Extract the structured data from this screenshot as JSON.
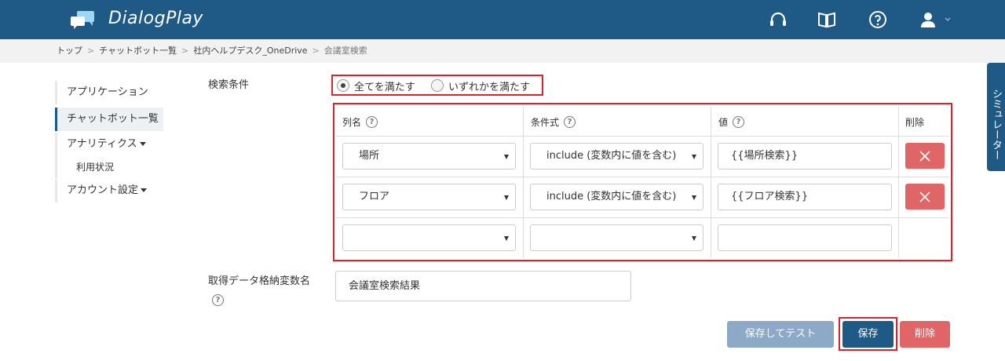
{
  "header": {
    "app_name": "DialogPlay",
    "icons": [
      "headset-icon",
      "book-icon",
      "help-icon",
      "user-icon"
    ],
    "color": "#1f5a87"
  },
  "breadcrumb": {
    "items": [
      "トップ",
      "チャットボット一覧",
      "社内ヘルプデスク_OneDrive"
    ],
    "current": "会議室検索",
    "separator": ">"
  },
  "sidebar": {
    "items": [
      {
        "label": "アプリケーション"
      },
      {
        "label": "チャットボット一覧"
      },
      {
        "label": "アナリティクス"
      },
      {
        "label": "利用状況"
      },
      {
        "label": "アカウント設定"
      }
    ]
  },
  "search": {
    "label": "検索条件",
    "options": [
      {
        "label": "全てを満たす",
        "checked": true
      },
      {
        "label": "いずれかを満たす",
        "checked": false
      }
    ]
  },
  "table": {
    "headers": [
      "列名",
      "条件式",
      "値",
      "削除"
    ],
    "rows": [
      {
        "column": "場所",
        "condition": "include (変数内に値を含む)",
        "value": "{{場所検索}}"
      },
      {
        "column": "フロア",
        "condition": "include (変数内に値を含む)",
        "value": "{{フロア検索}}"
      },
      {
        "column": "",
        "condition": "",
        "value": ""
      }
    ]
  },
  "result_var": {
    "label": "取得データ格納変数名",
    "value": "会議室検索結果"
  },
  "buttons": {
    "save_test": "保存してテスト",
    "save": "保存",
    "delete": "削除"
  },
  "simulator": {
    "label": "シミュレーター"
  },
  "colors": {
    "primary": "#1f5a87",
    "danger": "#e06566",
    "disabled": "#8ca9c8",
    "highlight": "#d9232e"
  }
}
